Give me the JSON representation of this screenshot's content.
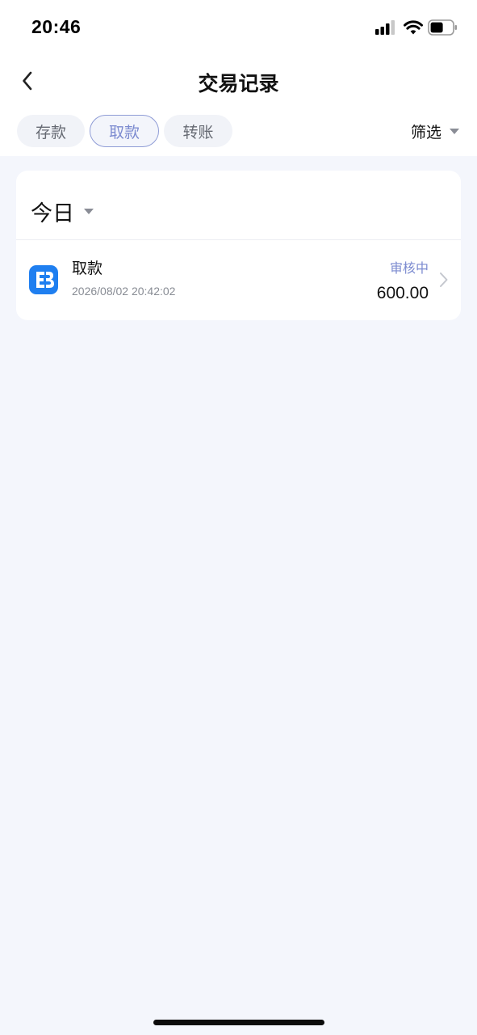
{
  "status_bar": {
    "time": "20:46",
    "icons": [
      "signal-icon",
      "wifi-icon",
      "battery-icon"
    ]
  },
  "nav": {
    "back_icon": "chevron-left-icon",
    "title": "交易记录"
  },
  "tabs": [
    {
      "label": "存款",
      "selected": false
    },
    {
      "label": "取款",
      "selected": true
    },
    {
      "label": "转账",
      "selected": false
    }
  ],
  "filter": {
    "label": "筛选",
    "icon": "caret-down-icon"
  },
  "records": {
    "period_label": "今日",
    "period_icon": "caret-down-icon",
    "items": [
      {
        "icon": "app-logo-icon",
        "type": "取款",
        "datetime": "2026/08/02 20:42:02",
        "status": "审核中",
        "amount": "600.00",
        "action_icon": "chevron-right-icon"
      }
    ]
  },
  "colors": {
    "accent": "#7c8bd0",
    "background": "#f4f6fc",
    "logo_blue": "#1f7ff0"
  }
}
